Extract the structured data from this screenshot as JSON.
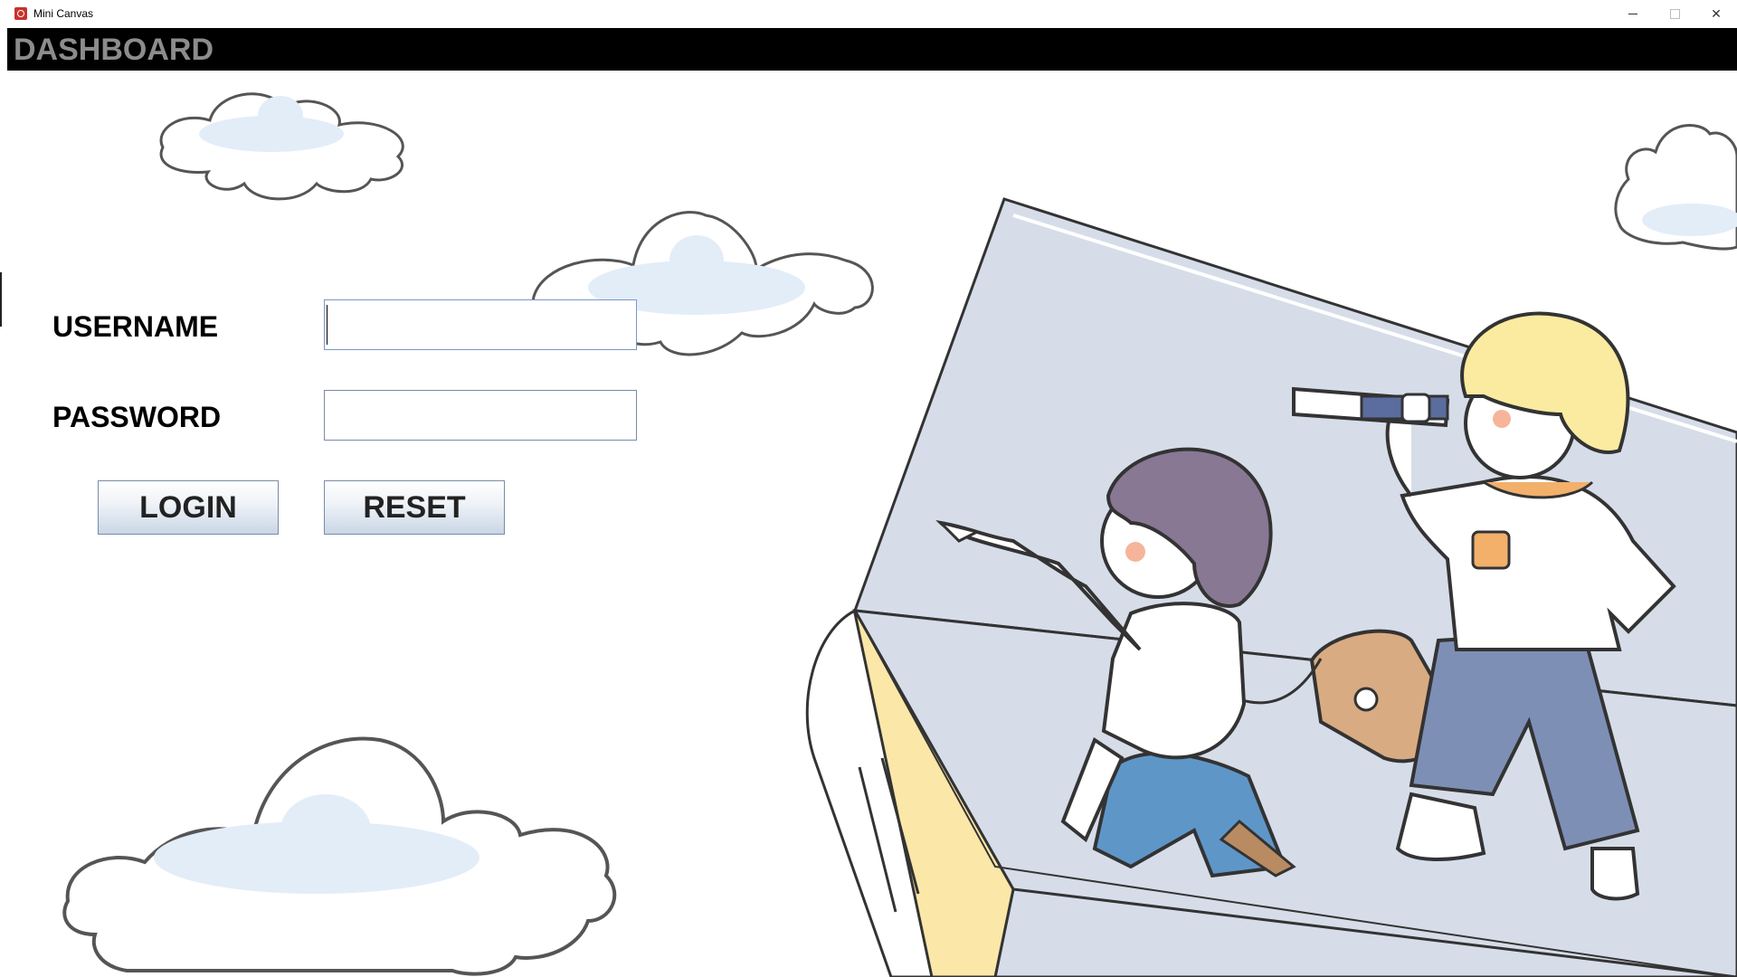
{
  "window": {
    "title": "Mini Canvas",
    "controls": [
      "minimize",
      "maximize",
      "close"
    ]
  },
  "header": {
    "title": "DASHBOARD"
  },
  "login_form": {
    "username_label": "USERNAME",
    "username_value": "",
    "password_label": "PASSWORD",
    "password_value": "",
    "login_button": "LOGIN",
    "reset_button": "RESET"
  },
  "colors": {
    "header_bg": "#000000",
    "header_text": "#8c8c8c",
    "cloud_fill": "#e3edf8",
    "cloud_outline": "#555555",
    "book_page_blue": "#d6dde9",
    "book_edge_yellow": "#fbe7a8"
  },
  "illustration": {
    "description_icons": [
      "cloud-icon",
      "book-icon",
      "telescope-icon",
      "child-figure-icon"
    ]
  }
}
